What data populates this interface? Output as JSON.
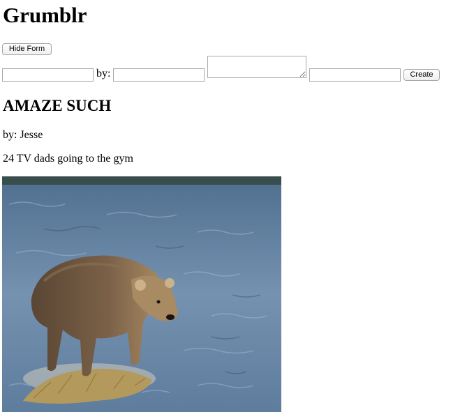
{
  "app": {
    "title": "Grumblr"
  },
  "form": {
    "hide_button_label": "Hide Form",
    "by_label": "by:",
    "title_value": "",
    "author_value": "",
    "content_value": "",
    "url_value": "",
    "create_button_label": "Create"
  },
  "posts": [
    {
      "title": "AMAZE SUCH",
      "author_line": "by: Jesse",
      "body": "24 TV dads going to the gym",
      "image": {
        "subject": "brown-bear-standing-on-grass-tuft-in-river"
      }
    }
  ],
  "colors": {
    "water": "#6f8aa8",
    "bear": "#6d5640",
    "grass": "#b39a5c"
  }
}
